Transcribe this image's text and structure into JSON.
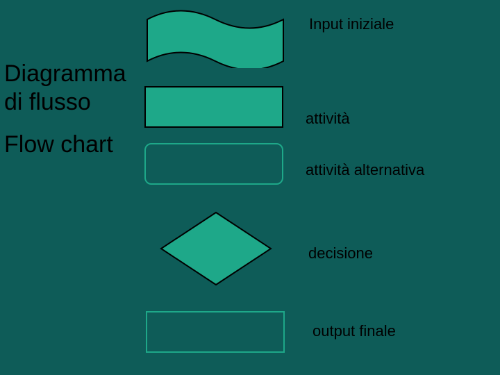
{
  "title_line1": "Diagramma",
  "title_line2": "di flusso",
  "subtitle": "Flow chart",
  "legend": {
    "input": "Input iniziale",
    "activity": "attività",
    "activity_alt": "attività alternativa",
    "decision": "decisione",
    "output": "output finale"
  },
  "colors": {
    "background": "#0e5c58",
    "shape_fill": "#1ea889",
    "shape_stroke": "#000000",
    "outline_stroke": "#1ea889"
  }
}
